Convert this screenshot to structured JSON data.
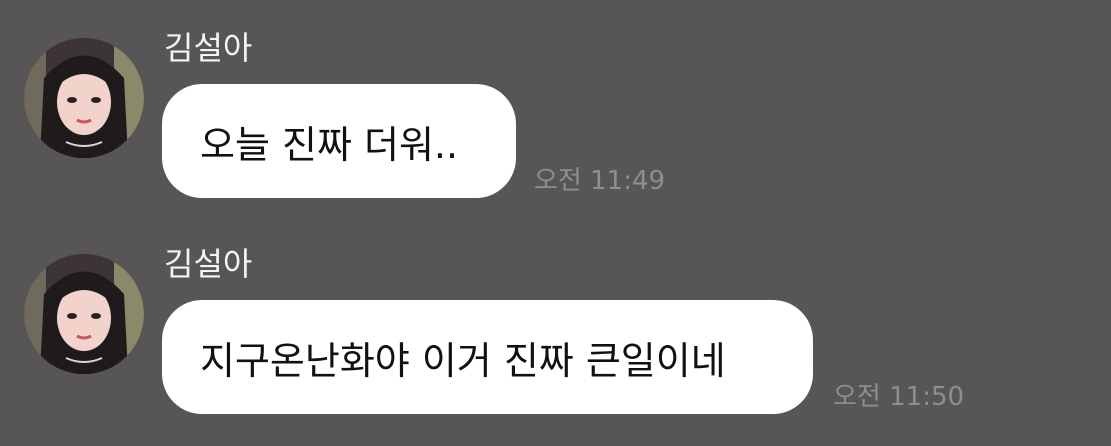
{
  "messages": [
    {
      "sender": "김설아",
      "text": "오늘 진짜 더워..",
      "time": "오전 11:49",
      "avatar_icon": "profile-photo"
    },
    {
      "sender": "김설아",
      "text": "지구온난화야 이거 진짜 큰일이네",
      "time": "오전 11:50",
      "avatar_icon": "profile-photo"
    }
  ],
  "colors": {
    "background": "#575556",
    "bubble": "#ffffff",
    "sender_text": "#f4f4f4",
    "time_text": "#8f8d8e"
  }
}
